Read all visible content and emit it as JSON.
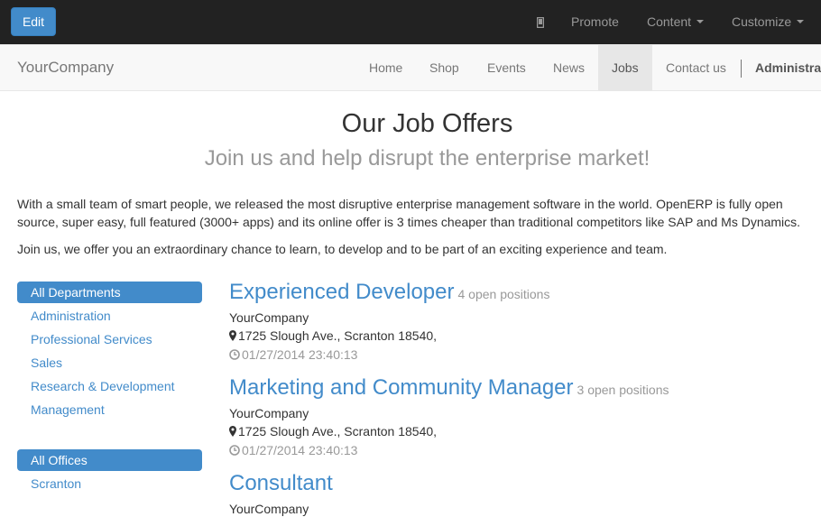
{
  "topbar": {
    "edit_label": "Edit",
    "mobile_icon": "mobile-icon",
    "promote_label": "Promote",
    "content_label": "Content",
    "customize_label": "Customize"
  },
  "navbar": {
    "brand": "YourCompany",
    "items": [
      "Home",
      "Shop",
      "Events",
      "News",
      "Jobs",
      "Contact us"
    ],
    "active": "Jobs",
    "admin_label": "Administra"
  },
  "page": {
    "title": "Our Job Offers",
    "subtitle": "Join us and help disrupt the enterprise market!",
    "intro": "With a small team of smart people, we released the most disruptive enterprise management software in the world. OpenERP is fully open source, super easy, full featured (3000+ apps) and its online offer is 3 times cheaper than traditional competitors like SAP and Ms Dynamics.",
    "intro2": "Join us, we offer you an extraordinary chance to learn, to develop and to be part of an exciting experience and team."
  },
  "departments": [
    "All Departments",
    "Administration",
    "Professional Services",
    "Sales",
    "Research & Development",
    "Management"
  ],
  "offices": [
    "All Offices",
    "Scranton"
  ],
  "jobs": [
    {
      "title": "Experienced Developer",
      "count": "4 open positions",
      "company": "YourCompany",
      "address": "1725 Slough Ave., Scranton 18540,",
      "date": "01/27/2014 23:40:13"
    },
    {
      "title": "Marketing and Community Manager",
      "count": "3 open positions",
      "company": "YourCompany",
      "address": "1725 Slough Ave., Scranton 18540,",
      "date": "01/27/2014 23:40:13"
    },
    {
      "title": "Consultant",
      "count": "",
      "company": "YourCompany"
    }
  ],
  "colors": {
    "accent": "#428bca",
    "topbar": "#222222",
    "navbar": "#f8f8f8"
  }
}
